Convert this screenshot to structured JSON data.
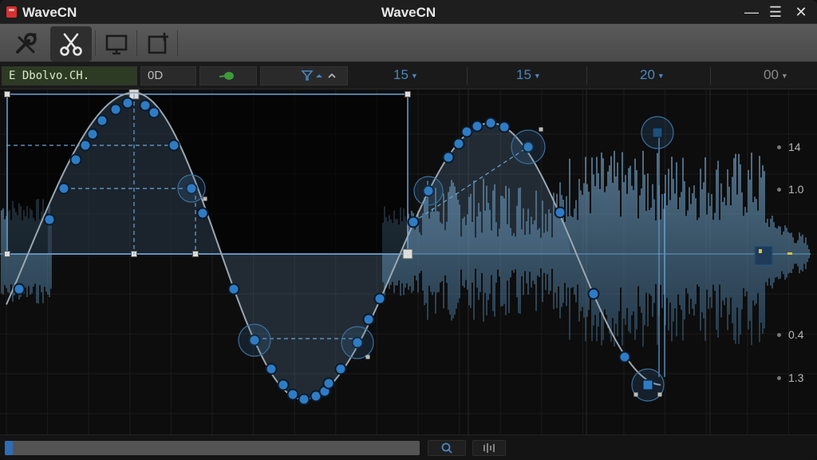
{
  "titlebar": {
    "app_name": "WaveCN",
    "window_title": "WaveCN",
    "minimize_glyph": "—",
    "menu_glyph": "☰",
    "close_glyph": "✕"
  },
  "toolbar": {
    "tools": [
      "wrench-tool",
      "scissors-tool",
      "monitor-tool",
      "add-frame-tool"
    ],
    "active_tool": "scissors-tool"
  },
  "ruler": {
    "clip_label": "E Dbolvo.CH.",
    "field_value": "0D",
    "markers": [
      {
        "label": "15",
        "color": "#4a86c0"
      },
      {
        "label": "15",
        "color": "#4a86c0"
      },
      {
        "label": "20",
        "color": "#4a86c0"
      },
      {
        "label": "00",
        "color": "#888888"
      }
    ]
  },
  "axis": {
    "right_labels": [
      "14",
      "1.0",
      "0.4",
      "1.3"
    ]
  },
  "colors": {
    "accent": "#3e8fd6",
    "curve": "#9aa7b2",
    "selection": "#6aa4d8",
    "waveform": "#5d8aad",
    "clip_label_bg": "#2d3b24"
  },
  "bottombar": {
    "scroll_position": 0.0,
    "scroll_visible_fraction": 0.02
  }
}
